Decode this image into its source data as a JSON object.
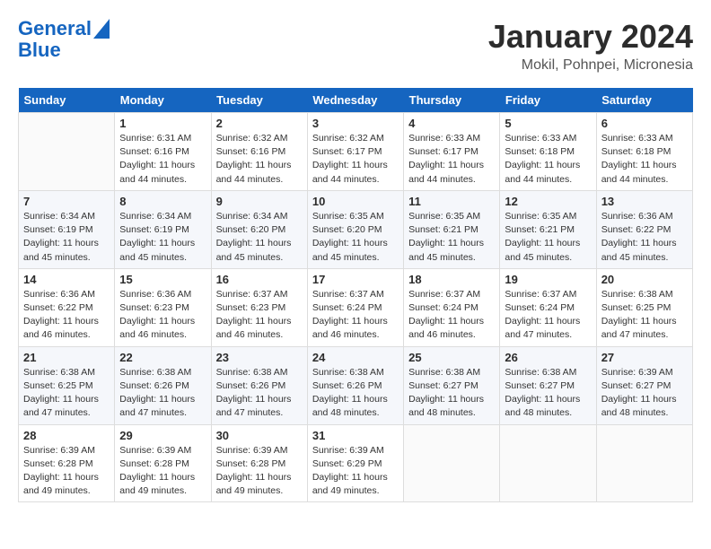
{
  "header": {
    "logo_line1": "General",
    "logo_line2": "Blue",
    "month": "January 2024",
    "location": "Mokil, Pohnpei, Micronesia"
  },
  "weekdays": [
    "Sunday",
    "Monday",
    "Tuesday",
    "Wednesday",
    "Thursday",
    "Friday",
    "Saturday"
  ],
  "weeks": [
    [
      {
        "num": "",
        "sunrise": "",
        "sunset": "",
        "daylight": ""
      },
      {
        "num": "1",
        "sunrise": "Sunrise: 6:31 AM",
        "sunset": "Sunset: 6:16 PM",
        "daylight": "Daylight: 11 hours and 44 minutes."
      },
      {
        "num": "2",
        "sunrise": "Sunrise: 6:32 AM",
        "sunset": "Sunset: 6:16 PM",
        "daylight": "Daylight: 11 hours and 44 minutes."
      },
      {
        "num": "3",
        "sunrise": "Sunrise: 6:32 AM",
        "sunset": "Sunset: 6:17 PM",
        "daylight": "Daylight: 11 hours and 44 minutes."
      },
      {
        "num": "4",
        "sunrise": "Sunrise: 6:33 AM",
        "sunset": "Sunset: 6:17 PM",
        "daylight": "Daylight: 11 hours and 44 minutes."
      },
      {
        "num": "5",
        "sunrise": "Sunrise: 6:33 AM",
        "sunset": "Sunset: 6:18 PM",
        "daylight": "Daylight: 11 hours and 44 minutes."
      },
      {
        "num": "6",
        "sunrise": "Sunrise: 6:33 AM",
        "sunset": "Sunset: 6:18 PM",
        "daylight": "Daylight: 11 hours and 44 minutes."
      }
    ],
    [
      {
        "num": "7",
        "sunrise": "Sunrise: 6:34 AM",
        "sunset": "Sunset: 6:19 PM",
        "daylight": "Daylight: 11 hours and 45 minutes."
      },
      {
        "num": "8",
        "sunrise": "Sunrise: 6:34 AM",
        "sunset": "Sunset: 6:19 PM",
        "daylight": "Daylight: 11 hours and 45 minutes."
      },
      {
        "num": "9",
        "sunrise": "Sunrise: 6:34 AM",
        "sunset": "Sunset: 6:20 PM",
        "daylight": "Daylight: 11 hours and 45 minutes."
      },
      {
        "num": "10",
        "sunrise": "Sunrise: 6:35 AM",
        "sunset": "Sunset: 6:20 PM",
        "daylight": "Daylight: 11 hours and 45 minutes."
      },
      {
        "num": "11",
        "sunrise": "Sunrise: 6:35 AM",
        "sunset": "Sunset: 6:21 PM",
        "daylight": "Daylight: 11 hours and 45 minutes."
      },
      {
        "num": "12",
        "sunrise": "Sunrise: 6:35 AM",
        "sunset": "Sunset: 6:21 PM",
        "daylight": "Daylight: 11 hours and 45 minutes."
      },
      {
        "num": "13",
        "sunrise": "Sunrise: 6:36 AM",
        "sunset": "Sunset: 6:22 PM",
        "daylight": "Daylight: 11 hours and 45 minutes."
      }
    ],
    [
      {
        "num": "14",
        "sunrise": "Sunrise: 6:36 AM",
        "sunset": "Sunset: 6:22 PM",
        "daylight": "Daylight: 11 hours and 46 minutes."
      },
      {
        "num": "15",
        "sunrise": "Sunrise: 6:36 AM",
        "sunset": "Sunset: 6:23 PM",
        "daylight": "Daylight: 11 hours and 46 minutes."
      },
      {
        "num": "16",
        "sunrise": "Sunrise: 6:37 AM",
        "sunset": "Sunset: 6:23 PM",
        "daylight": "Daylight: 11 hours and 46 minutes."
      },
      {
        "num": "17",
        "sunrise": "Sunrise: 6:37 AM",
        "sunset": "Sunset: 6:24 PM",
        "daylight": "Daylight: 11 hours and 46 minutes."
      },
      {
        "num": "18",
        "sunrise": "Sunrise: 6:37 AM",
        "sunset": "Sunset: 6:24 PM",
        "daylight": "Daylight: 11 hours and 46 minutes."
      },
      {
        "num": "19",
        "sunrise": "Sunrise: 6:37 AM",
        "sunset": "Sunset: 6:24 PM",
        "daylight": "Daylight: 11 hours and 47 minutes."
      },
      {
        "num": "20",
        "sunrise": "Sunrise: 6:38 AM",
        "sunset": "Sunset: 6:25 PM",
        "daylight": "Daylight: 11 hours and 47 minutes."
      }
    ],
    [
      {
        "num": "21",
        "sunrise": "Sunrise: 6:38 AM",
        "sunset": "Sunset: 6:25 PM",
        "daylight": "Daylight: 11 hours and 47 minutes."
      },
      {
        "num": "22",
        "sunrise": "Sunrise: 6:38 AM",
        "sunset": "Sunset: 6:26 PM",
        "daylight": "Daylight: 11 hours and 47 minutes."
      },
      {
        "num": "23",
        "sunrise": "Sunrise: 6:38 AM",
        "sunset": "Sunset: 6:26 PM",
        "daylight": "Daylight: 11 hours and 47 minutes."
      },
      {
        "num": "24",
        "sunrise": "Sunrise: 6:38 AM",
        "sunset": "Sunset: 6:26 PM",
        "daylight": "Daylight: 11 hours and 48 minutes."
      },
      {
        "num": "25",
        "sunrise": "Sunrise: 6:38 AM",
        "sunset": "Sunset: 6:27 PM",
        "daylight": "Daylight: 11 hours and 48 minutes."
      },
      {
        "num": "26",
        "sunrise": "Sunrise: 6:38 AM",
        "sunset": "Sunset: 6:27 PM",
        "daylight": "Daylight: 11 hours and 48 minutes."
      },
      {
        "num": "27",
        "sunrise": "Sunrise: 6:39 AM",
        "sunset": "Sunset: 6:27 PM",
        "daylight": "Daylight: 11 hours and 48 minutes."
      }
    ],
    [
      {
        "num": "28",
        "sunrise": "Sunrise: 6:39 AM",
        "sunset": "Sunset: 6:28 PM",
        "daylight": "Daylight: 11 hours and 49 minutes."
      },
      {
        "num": "29",
        "sunrise": "Sunrise: 6:39 AM",
        "sunset": "Sunset: 6:28 PM",
        "daylight": "Daylight: 11 hours and 49 minutes."
      },
      {
        "num": "30",
        "sunrise": "Sunrise: 6:39 AM",
        "sunset": "Sunset: 6:28 PM",
        "daylight": "Daylight: 11 hours and 49 minutes."
      },
      {
        "num": "31",
        "sunrise": "Sunrise: 6:39 AM",
        "sunset": "Sunset: 6:29 PM",
        "daylight": "Daylight: 11 hours and 49 minutes."
      },
      {
        "num": "",
        "sunrise": "",
        "sunset": "",
        "daylight": ""
      },
      {
        "num": "",
        "sunrise": "",
        "sunset": "",
        "daylight": ""
      },
      {
        "num": "",
        "sunrise": "",
        "sunset": "",
        "daylight": ""
      }
    ]
  ]
}
